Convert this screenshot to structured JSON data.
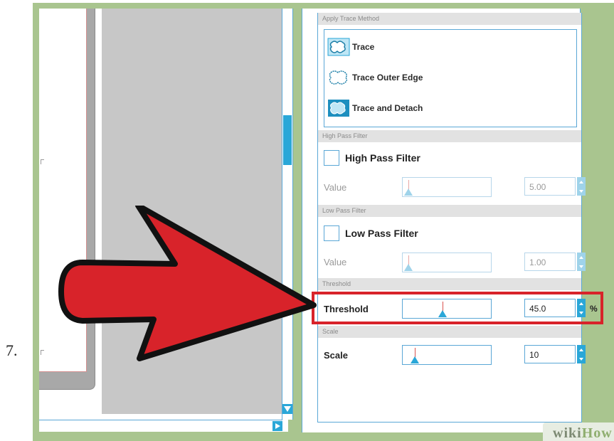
{
  "step_number": "7.",
  "panel": {
    "trace_method": {
      "header": "Apply Trace Method",
      "items": [
        {
          "label": "Trace",
          "icon": "trace-icon"
        },
        {
          "label": "Trace Outer Edge",
          "icon": "trace-outer-edge-icon"
        },
        {
          "label": "Trace and Detach",
          "icon": "trace-and-detach-icon"
        }
      ]
    },
    "high_pass": {
      "header": "High Pass Filter",
      "checkbox_label": "High Pass Filter",
      "checked": false,
      "value_label": "Value",
      "value": "5.00",
      "slider_level": 0.02
    },
    "low_pass": {
      "header": "Low Pass Filter",
      "checkbox_label": "Low Pass Filter",
      "checked": false,
      "value_label": "Value",
      "value": "1.00",
      "slider_level": 0.02
    },
    "threshold": {
      "header": "Threshold",
      "label": "Threshold",
      "value": "45.0",
      "unit": "%",
      "slider_level": 0.45
    },
    "scale": {
      "header": "Scale",
      "label": "Scale",
      "value": "10",
      "slider_level": 0.1
    }
  },
  "annotation": {
    "arrow_color": "#d8232a",
    "highlight_color": "#d8232a"
  },
  "watermark": {
    "wiki": "wiki",
    "how": "How"
  },
  "colors": {
    "accent": "#2aa7d8",
    "frame": "#a9c58f"
  }
}
